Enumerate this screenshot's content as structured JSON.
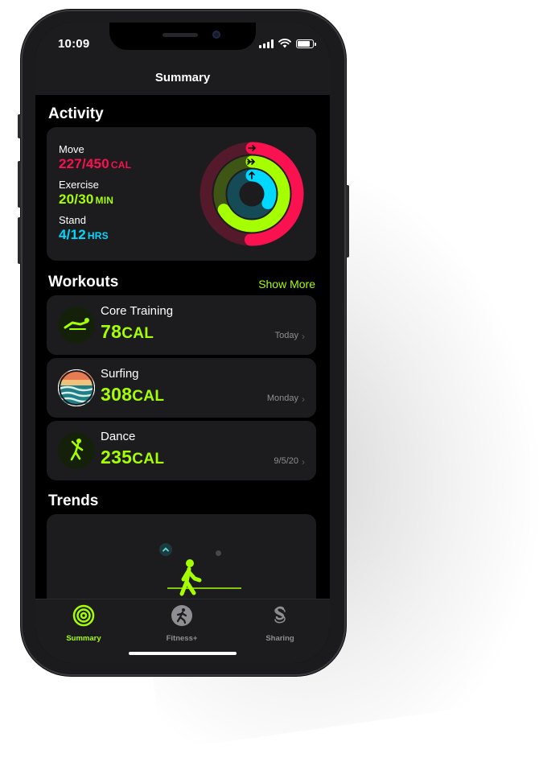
{
  "status_bar": {
    "time": "10:09"
  },
  "nav": {
    "title": "Summary"
  },
  "activity": {
    "title": "Activity",
    "move": {
      "label": "Move",
      "value": "227/450",
      "unit": "CAL",
      "color": "#fa114f",
      "progress": 0.504
    },
    "exercise": {
      "label": "Exercise",
      "value": "20/30",
      "unit": "MIN",
      "color": "#a6ff00",
      "progress": 0.667
    },
    "stand": {
      "label": "Stand",
      "value": "4/12",
      "unit": "HRS",
      "color": "#00d8ff",
      "progress": 0.333
    }
  },
  "workouts": {
    "title": "Workouts",
    "show_more": "Show More",
    "items": [
      {
        "name": "Core Training",
        "value": "78",
        "unit": "CAL",
        "date": "Today",
        "icon": "core-training-icon"
      },
      {
        "name": "Surfing",
        "value": "308",
        "unit": "CAL",
        "date": "Monday",
        "icon": "surfing-icon"
      },
      {
        "name": "Dance",
        "value": "235",
        "unit": "CAL",
        "date": "9/5/20",
        "icon": "dance-icon"
      }
    ]
  },
  "trends": {
    "title": "Trends"
  },
  "tabbar": {
    "tabs": [
      {
        "label": "Summary",
        "icon": "activity-rings-icon",
        "active": true
      },
      {
        "label": "Fitness+",
        "icon": "fitness-plus-icon",
        "active": false
      },
      {
        "label": "Sharing",
        "icon": "sharing-icon",
        "active": false
      }
    ]
  },
  "colors": {
    "accent": "#a6ff00",
    "move": "#fa114f",
    "exercise": "#a6ff00",
    "stand": "#00d8ff",
    "card": "#1c1c1e"
  }
}
